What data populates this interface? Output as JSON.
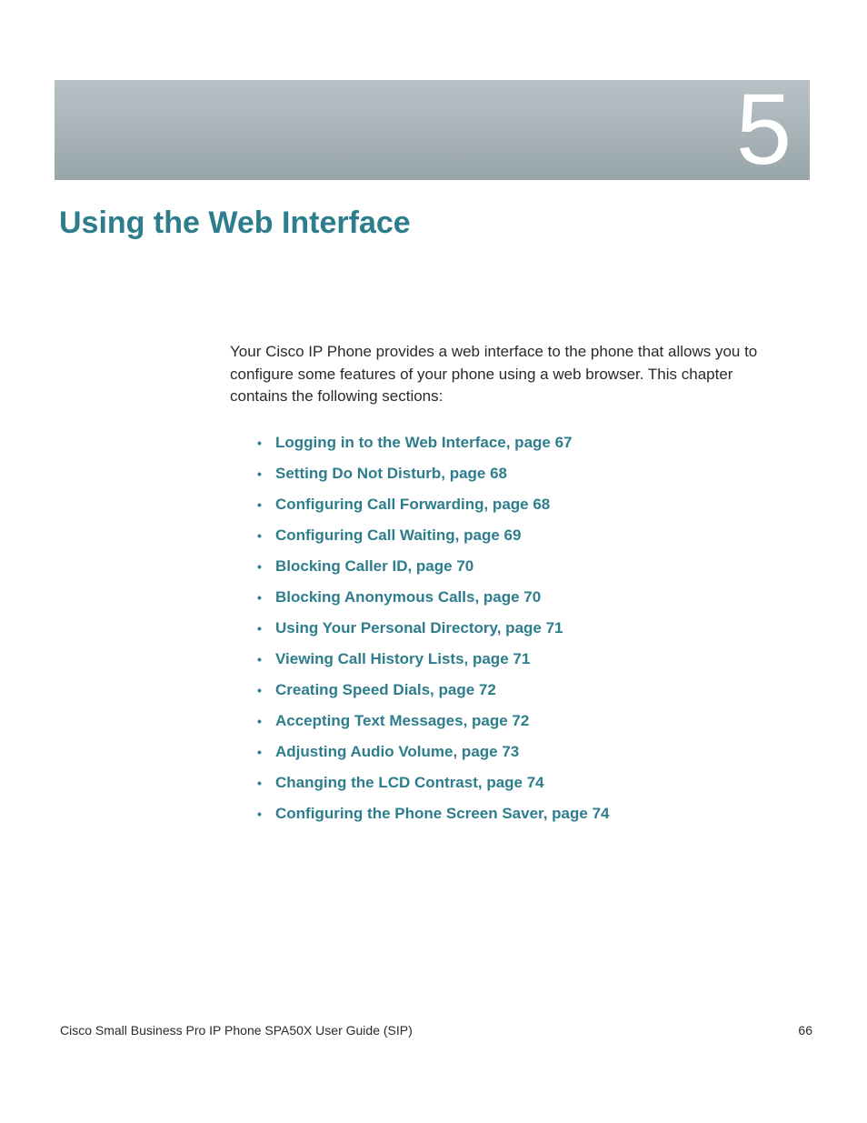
{
  "chapter": {
    "number": "5",
    "title": "Using the Web Interface"
  },
  "intro": "Your Cisco IP Phone provides a web interface to the phone that allows you to configure some features of your phone using a web browser. This chapter contains the following sections:",
  "toc": [
    "Logging in to the Web Interface, page 67",
    "Setting Do Not Disturb, page 68",
    "Configuring Call Forwarding, page 68",
    "Configuring Call Waiting, page 69",
    "Blocking Caller ID, page 70",
    "Blocking Anonymous Calls, page 70",
    "Using Your Personal Directory, page 71",
    "Viewing Call History Lists, page 71",
    "Creating Speed Dials, page 72",
    "Accepting Text Messages, page 72",
    "Adjusting Audio Volume, page 73",
    "Changing the LCD Contrast, page 74",
    "Configuring the Phone Screen Saver, page 74"
  ],
  "footer": {
    "doc_title": "Cisco Small Business Pro IP Phone SPA50X User Guide (SIP)",
    "page_number": "66"
  }
}
